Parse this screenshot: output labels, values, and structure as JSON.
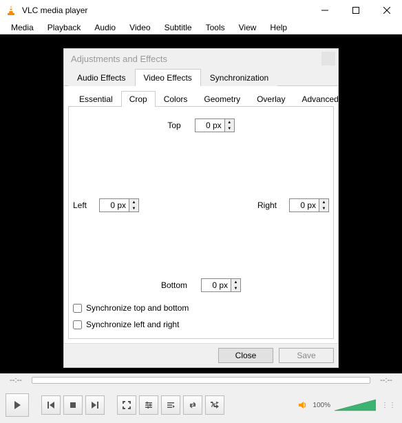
{
  "window": {
    "title": "VLC media player"
  },
  "menu": {
    "items": [
      "Media",
      "Playback",
      "Audio",
      "Video",
      "Subtitle",
      "Tools",
      "View",
      "Help"
    ]
  },
  "dialog": {
    "title": "Adjustments and Effects",
    "tabs": {
      "audio": "Audio Effects",
      "video": "Video Effects",
      "sync": "Synchronization",
      "active": "video"
    },
    "subtabs": {
      "essential": "Essential",
      "crop": "Crop",
      "colors": "Colors",
      "geometry": "Geometry",
      "overlay": "Overlay",
      "advanced": "Advanced",
      "active": "crop"
    },
    "crop": {
      "top_label": "Top",
      "top_value": "0 px",
      "left_label": "Left",
      "left_value": "0 px",
      "right_label": "Right",
      "right_value": "0 px",
      "bottom_label": "Bottom",
      "bottom_value": "0 px",
      "sync_tb": "Synchronize top and bottom",
      "sync_lr": "Synchronize left and right",
      "sync_tb_checked": false,
      "sync_lr_checked": false
    },
    "buttons": {
      "close": "Close",
      "save": "Save"
    }
  },
  "seek": {
    "elapsed": "--:--",
    "remaining": "--:--"
  },
  "volume": {
    "percent": "100%"
  }
}
